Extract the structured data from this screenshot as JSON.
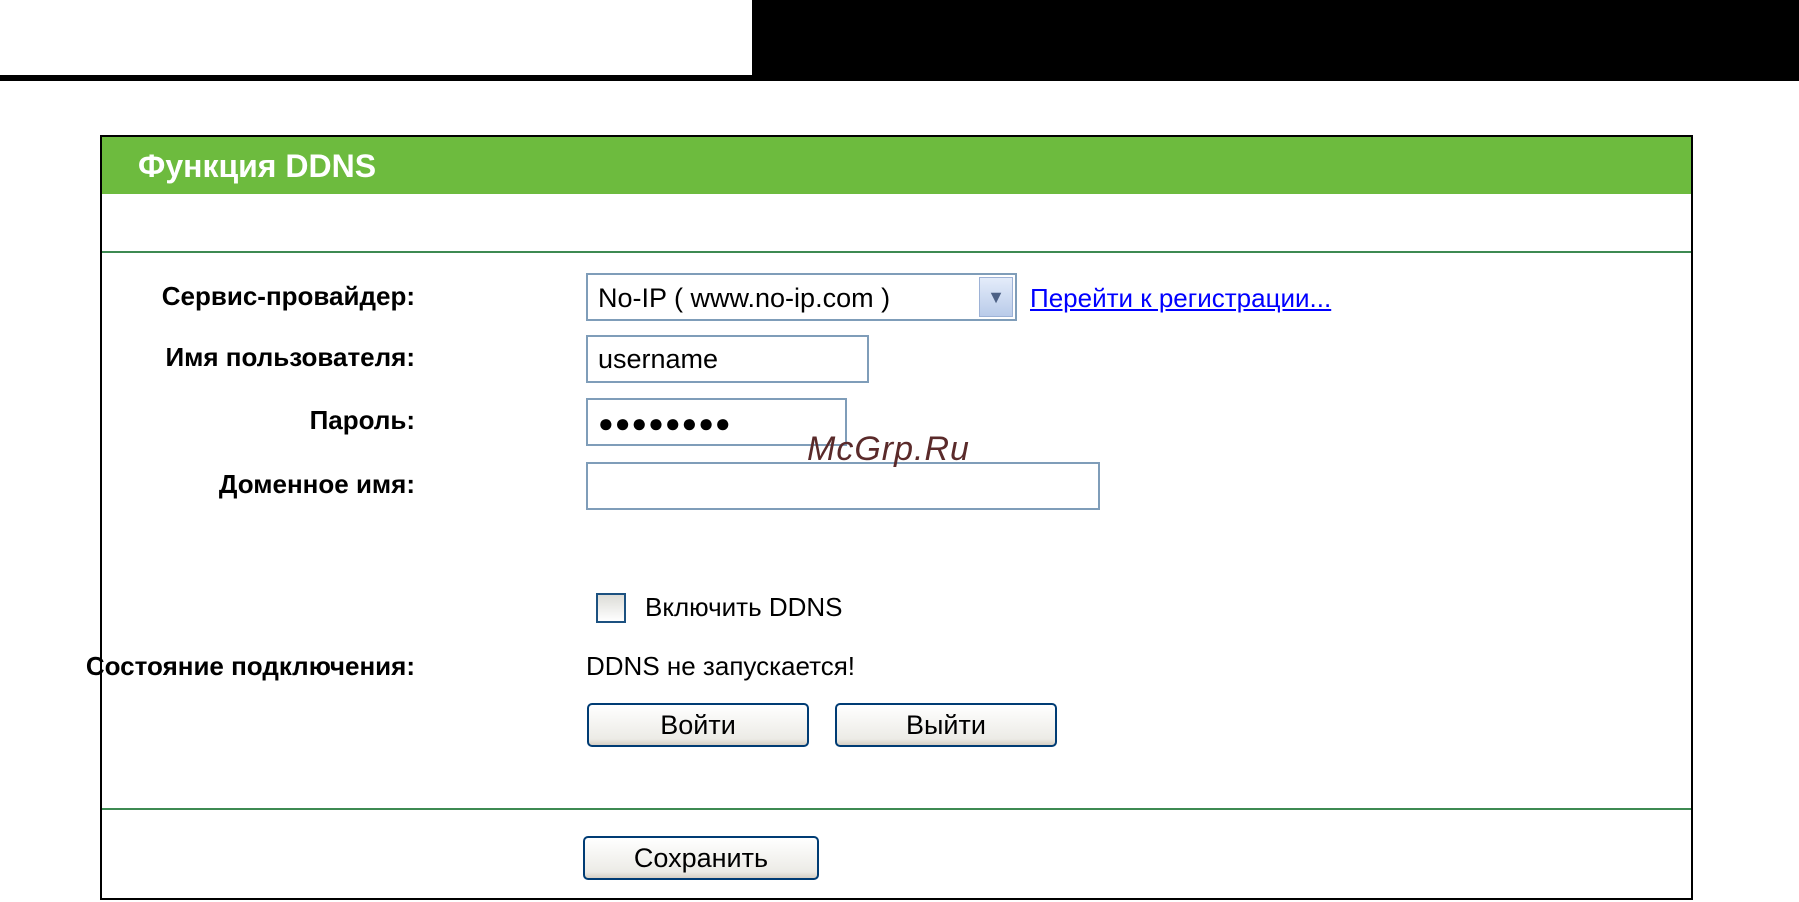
{
  "panel": {
    "title": "Функция DDNS"
  },
  "form": {
    "provider": {
      "label": "Сервис-провайдер:",
      "selected": "No-IP ( www.no-ip.com )",
      "register_link": "Перейти к регистрации..."
    },
    "username": {
      "label": "Имя пользователя:",
      "value": "username"
    },
    "password": {
      "label": "Пароль:",
      "masked_value": "●●●●●●●●"
    },
    "domain": {
      "label": "Доменное имя:",
      "value": ""
    },
    "enable_ddns": {
      "label": "Включить DDNS",
      "checked": false
    },
    "connection_status": {
      "label": "Состояние подключения:",
      "value": "DDNS не запускается!"
    },
    "buttons": {
      "login": "Войти",
      "logout": "Выйти",
      "save": "Сохранить"
    }
  },
  "watermark": "McGrp.Ru",
  "colors": {
    "header_green": "#6dbb3e",
    "separator_green": "#3d8a52",
    "link_blue": "#0000ff"
  }
}
